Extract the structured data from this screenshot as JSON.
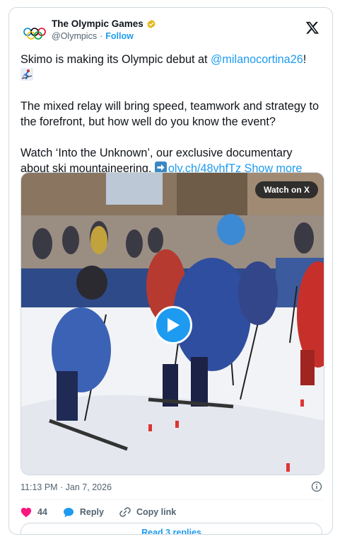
{
  "author": {
    "display_name": "The Olympic Games",
    "handle": "@Olympics",
    "separator": "·",
    "follow_label": "Follow"
  },
  "tweet": {
    "line1_prefix": "Skimo is making its Olympic debut at ",
    "line1_mention": "@milanocortina26",
    "line1_suffix": "!",
    "paragraph2": "The mixed relay will bring speed, teamwork and strategy to the forefront, but how well do you know the event?",
    "paragraph3": "Watch ‘Into the Unknown’, our exclusive documentary about ski mountaineering.",
    "link_text": "oly.ch/48vhfTz",
    "show_more": "Show more"
  },
  "media": {
    "watch_label": "Watch on X"
  },
  "meta": {
    "timestamp": "11:13 PM · Jan 7, 2026"
  },
  "actions": {
    "like_count": "44",
    "reply_label": "Reply",
    "copy_label": "Copy link"
  },
  "read_replies_label": "Read 3 replies",
  "colors": {
    "accent": "#1d9bf0",
    "like": "#f91880",
    "text": "#0f1419",
    "muted": "#536471"
  }
}
